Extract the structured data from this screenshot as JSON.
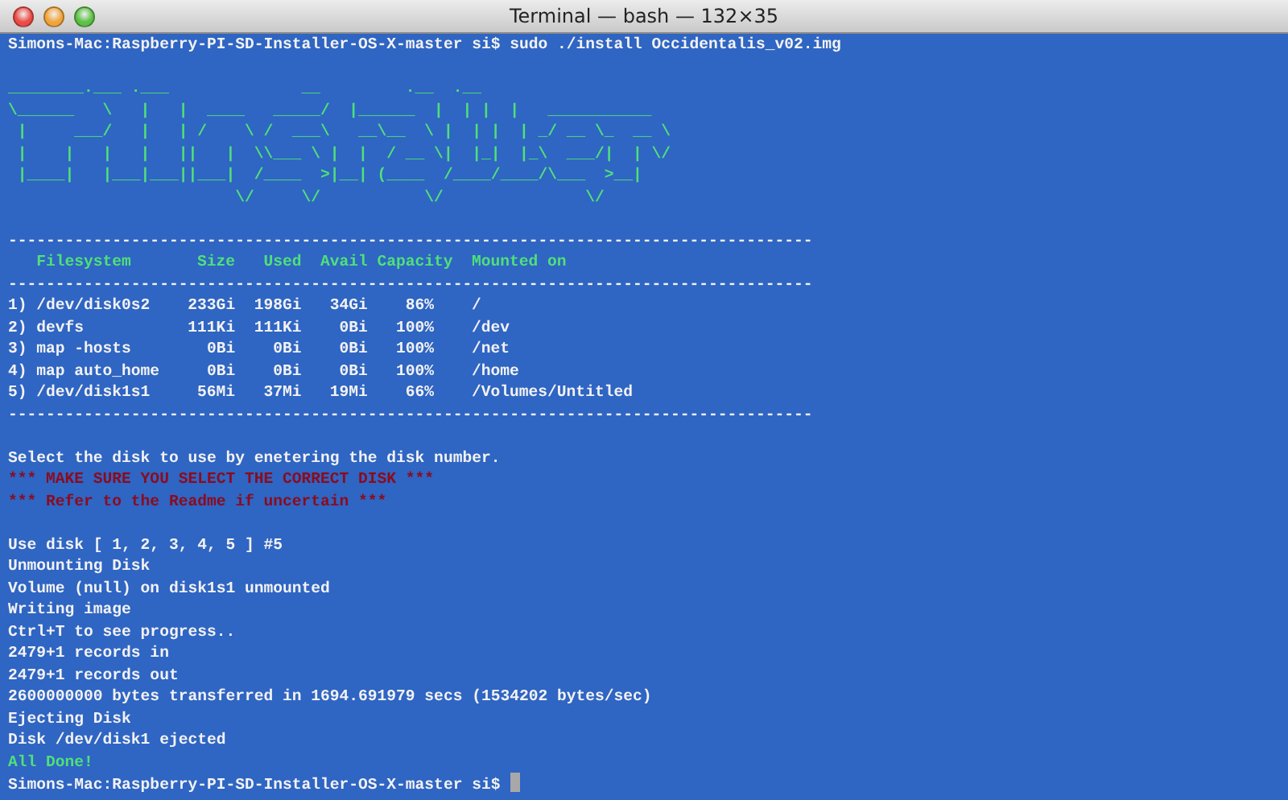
{
  "window": {
    "title": "Terminal — bash — 132×35"
  },
  "lines": [
    {
      "kind": "info",
      "text": "Simons-Mac:Raspberry-PI-SD-Installer-OS-X-master si$ sudo ./install Occidentalis_v02.img"
    },
    {
      "kind": "blank"
    },
    {
      "kind": "art",
      "text": "________.___ .___              __         .__  .__"
    },
    {
      "kind": "art",
      "text": "\\______   \\   |   |  ____   _____/  |______  |  | |  |   ___________"
    },
    {
      "kind": "art",
      "text": " |     ___/   |   | /    \\ /  ___\\   __\\__  \\ |  | |  | _/ __ \\_  __ \\"
    },
    {
      "kind": "art",
      "text": " |    |   |   |   ||   |  \\\\___ \\ |  |  / __ \\|  |_|  |_\\  ___/|  | \\/"
    },
    {
      "kind": "art",
      "text": " |____|   |___|___||___|  /____  >|__| (____  /____/____/\\___  >__|"
    },
    {
      "kind": "art",
      "text": "                        \\/     \\/           \\/               \\/"
    },
    {
      "kind": "blank"
    },
    {
      "kind": "info",
      "text": "-------------------------------------------------------------------------------------"
    },
    {
      "kind": "table_header",
      "cells": [
        "Filesystem",
        "Size",
        "Used",
        "Avail",
        "Capacity",
        "Mounted on"
      ]
    },
    {
      "kind": "info",
      "text": "-------------------------------------------------------------------------------------"
    },
    {
      "kind": "table_row",
      "cells": [
        "1) /dev/disk0s2",
        "233Gi",
        "198Gi",
        "34Gi",
        "86%",
        "/"
      ]
    },
    {
      "kind": "table_row",
      "cells": [
        "2) devfs",
        "111Ki",
        "111Ki",
        "0Bi",
        "100%",
        "/dev"
      ]
    },
    {
      "kind": "table_row",
      "cells": [
        "3) map -hosts",
        "0Bi",
        "0Bi",
        "0Bi",
        "100%",
        "/net"
      ]
    },
    {
      "kind": "table_row",
      "cells": [
        "4) map auto_home",
        "0Bi",
        "0Bi",
        "0Bi",
        "100%",
        "/home"
      ]
    },
    {
      "kind": "table_row",
      "cells": [
        "5) /dev/disk1s1",
        "56Mi",
        "37Mi",
        "19Mi",
        "66%",
        "/Volumes/Untitled"
      ]
    },
    {
      "kind": "info",
      "text": "-------------------------------------------------------------------------------------"
    },
    {
      "kind": "blank"
    },
    {
      "kind": "info",
      "text": "Select the disk to use by enetering the disk number."
    },
    {
      "kind": "warning",
      "text": "*** MAKE SURE YOU SELECT THE CORRECT DISK ***"
    },
    {
      "kind": "warning",
      "text": "*** Refer to the Readme if uncertain ***"
    },
    {
      "kind": "blank"
    },
    {
      "kind": "info",
      "text": "Use disk [ 1, 2, 3, 4, 5 ] #5"
    },
    {
      "kind": "info",
      "text": "Unmounting Disk"
    },
    {
      "kind": "info",
      "text": "Volume (null) on disk1s1 unmounted"
    },
    {
      "kind": "info",
      "text": "Writing image"
    },
    {
      "kind": "info",
      "text": "Ctrl+T to see progress.."
    },
    {
      "kind": "info",
      "text": "2479+1 records in"
    },
    {
      "kind": "info",
      "text": "2479+1 records out"
    },
    {
      "kind": "info",
      "text": "2600000000 bytes transferred in 1694.691979 secs (1534202 bytes/sec)"
    },
    {
      "kind": "info",
      "text": "Ejecting Disk"
    },
    {
      "kind": "info",
      "text": "Disk /dev/disk1 ejected"
    },
    {
      "kind": "success",
      "text": "All Done!"
    },
    {
      "kind": "prompt",
      "text": "Simons-Mac:Raspberry-PI-SD-Installer-OS-X-master si$"
    }
  ]
}
